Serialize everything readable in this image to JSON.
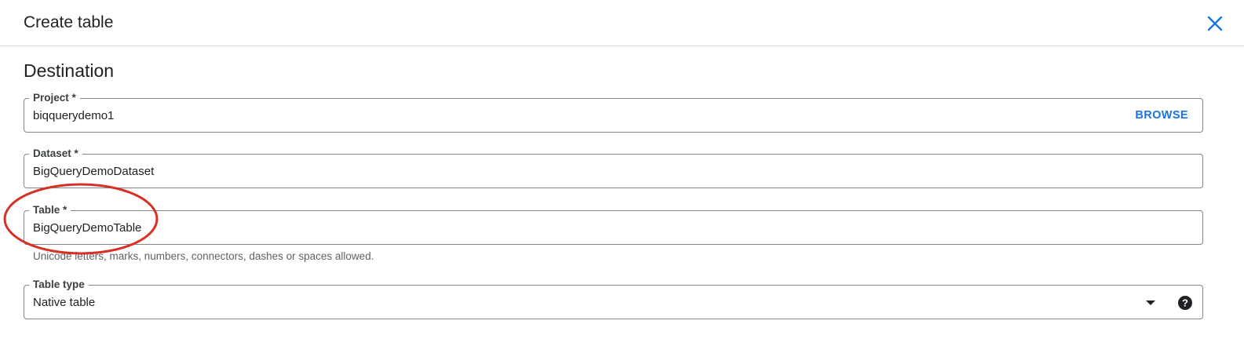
{
  "dialog": {
    "title": "Create table"
  },
  "section": {
    "title": "Destination"
  },
  "fields": {
    "project": {
      "label": "Project *",
      "value": "biqquerydemo1",
      "browse_label": "BROWSE"
    },
    "dataset": {
      "label": "Dataset *",
      "value": "BigQueryDemoDataset"
    },
    "table": {
      "label": "Table *",
      "value": "BigQueryDemoTable",
      "hint": "Unicode letters, marks, numbers, connectors, dashes or spaces allowed."
    },
    "table_type": {
      "label": "Table type",
      "value": "Native table"
    }
  },
  "icons": {
    "close": "close-icon",
    "dropdown": "chevron-down-icon",
    "help": "help-icon"
  },
  "colors": {
    "accent": "#1a73e8",
    "annotation": "#d93025",
    "border": "#80868b"
  }
}
